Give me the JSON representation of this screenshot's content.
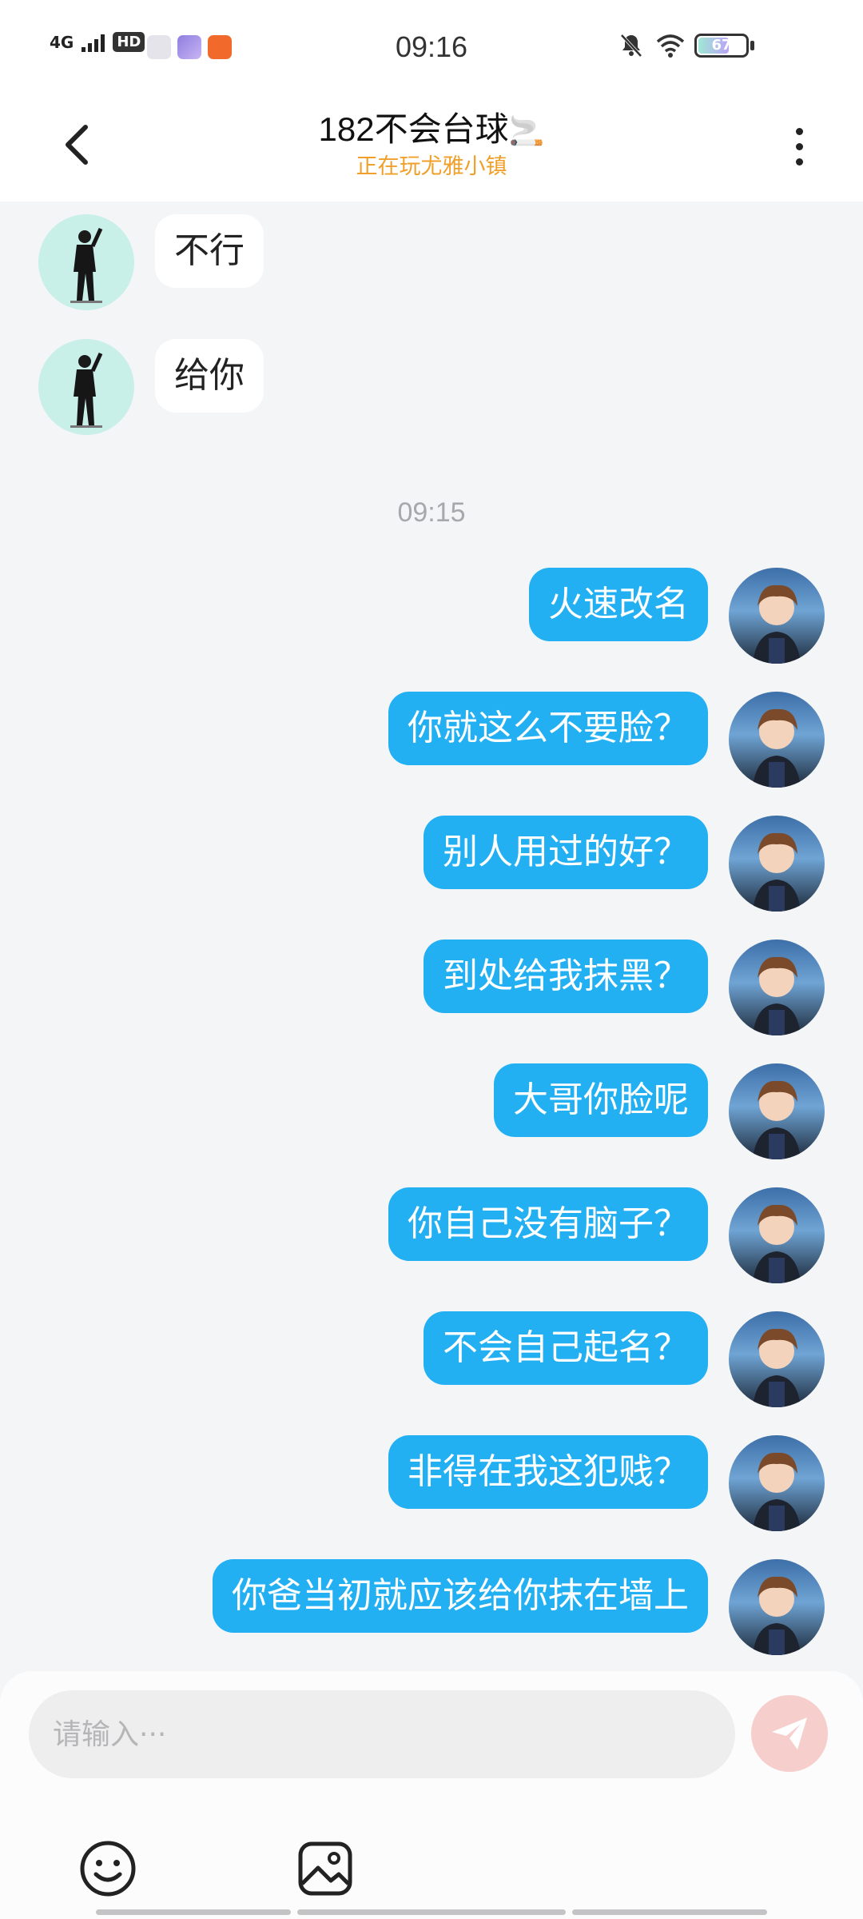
{
  "status_bar": {
    "network": "4G",
    "hd": "HD",
    "time": "09:16",
    "battery": 67,
    "battery_text": "67"
  },
  "header": {
    "title": "182不会台球",
    "title_emoji": "🚬",
    "subtitle": "正在玩尤雅小镇"
  },
  "messages_received": [
    {
      "text": "不行"
    },
    {
      "text": "给你"
    }
  ],
  "timestamp": "09:15",
  "messages_sent": [
    {
      "text": "火速改名"
    },
    {
      "text": "你就这么不要脸？"
    },
    {
      "text": "别人用过的好？"
    },
    {
      "text": "到处给我抹黑？"
    },
    {
      "text": "大哥你脸呢"
    },
    {
      "text": "你自己没有脑子？"
    },
    {
      "text": "不会自己起名？"
    },
    {
      "text": "非得在我这犯贱？"
    },
    {
      "text": "你爸当初就应该给你抹在墙上"
    }
  ],
  "composer": {
    "placeholder": "请输入···"
  },
  "colors": {
    "sent_bubble": "#22b0f3",
    "subtitle": "#f0a02a",
    "send_button": "#f6cfcd"
  },
  "icons": [
    "back-arrow-icon",
    "more-vertical-icon",
    "send-icon",
    "emoji-icon",
    "image-icon",
    "mute-bell-icon",
    "wifi-icon",
    "battery-icon"
  ]
}
